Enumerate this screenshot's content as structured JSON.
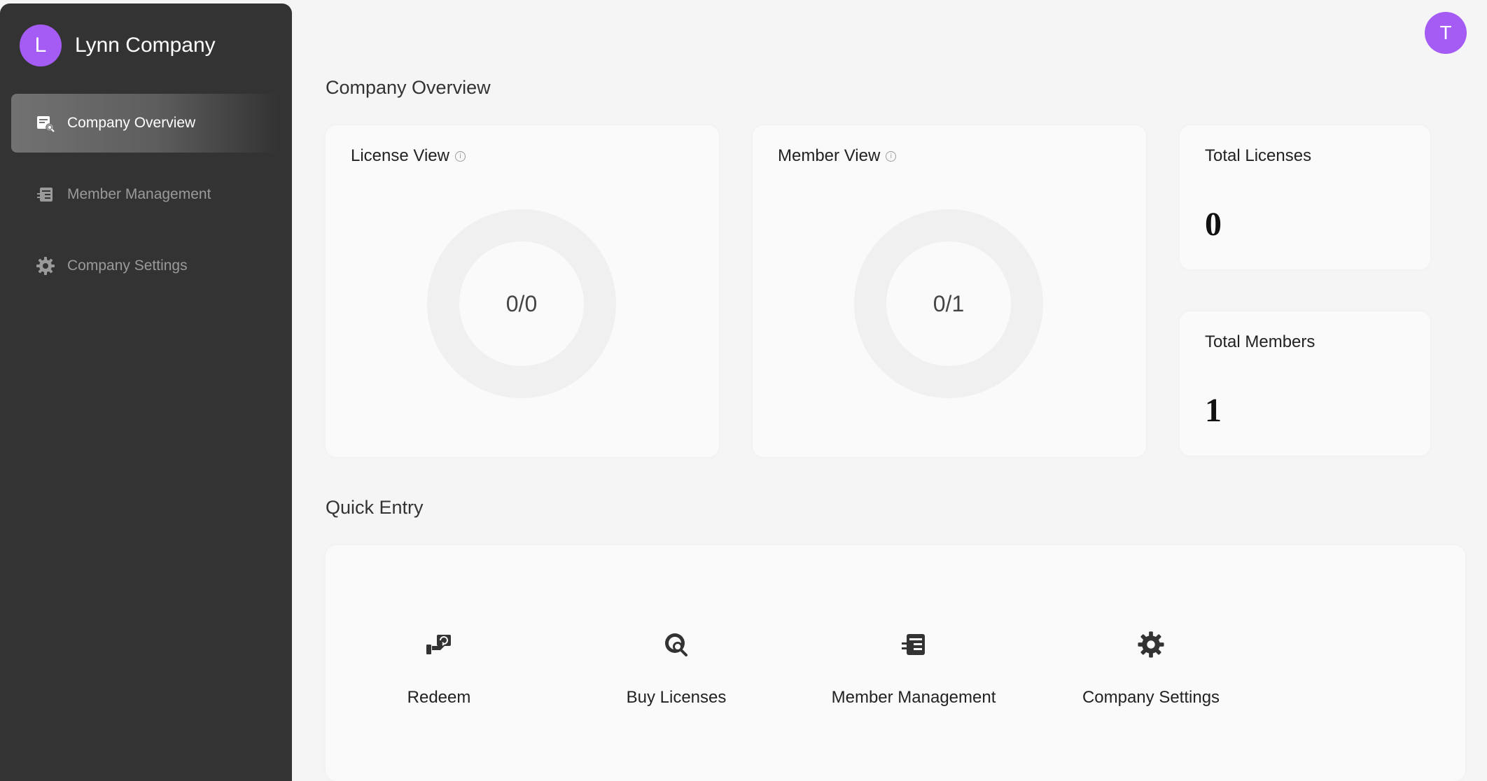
{
  "company": {
    "initial": "L",
    "name": "Lynn Company"
  },
  "user": {
    "initial": "T"
  },
  "sidebar": {
    "items": [
      {
        "label": "Company Overview",
        "icon": "overview-icon",
        "active": true
      },
      {
        "label": "Member Management",
        "icon": "member-management-icon",
        "active": false
      },
      {
        "label": "Company Settings",
        "icon": "gear-icon",
        "active": false
      }
    ]
  },
  "overview": {
    "title": "Company Overview",
    "license_view": {
      "title": "License View",
      "value": "0/0",
      "used": 0,
      "total": 0
    },
    "member_view": {
      "title": "Member View",
      "value": "0/1",
      "used": 0,
      "total": 1
    },
    "total_licenses": {
      "label": "Total Licenses",
      "value": "0"
    },
    "total_members": {
      "label": "Total Members",
      "value": "1"
    }
  },
  "quick_entry": {
    "title": "Quick Entry",
    "items": [
      {
        "label": "Redeem",
        "icon": "redeem-icon"
      },
      {
        "label": "Buy Licenses",
        "icon": "buy-licenses-icon"
      },
      {
        "label": "Member Management",
        "icon": "member-management-icon"
      },
      {
        "label": "Company Settings",
        "icon": "gear-icon"
      }
    ]
  },
  "colors": {
    "accent": "#a45cf5",
    "sidebar": "#333333",
    "background": "#f5f5f5",
    "card": "#fafafa"
  }
}
